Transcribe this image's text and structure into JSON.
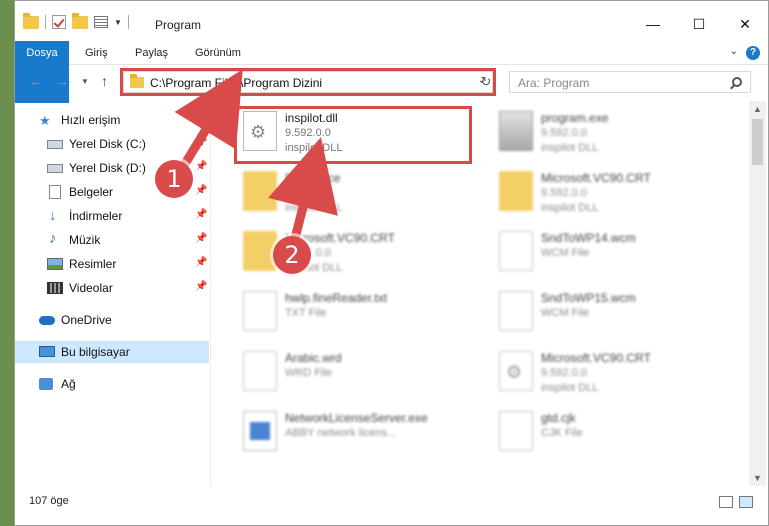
{
  "window": {
    "title": "Program"
  },
  "ribbon": {
    "tabs": [
      "Dosya",
      "Giriş",
      "Paylaş",
      "Görünüm"
    ]
  },
  "address": {
    "path": "C:\\Program Files\\Program Dizini"
  },
  "search": {
    "placeholder": "Ara: Program"
  },
  "sidebar": {
    "items": [
      {
        "label": "Hızlı erişim",
        "icon": "star-icon"
      },
      {
        "label": "Yerel Disk (C:)",
        "icon": "drive-icon"
      },
      {
        "label": "Yerel Disk (D:)",
        "icon": "drive-icon"
      },
      {
        "label": "Belgeler",
        "icon": "documents-icon"
      },
      {
        "label": "İndirmeler",
        "icon": "downloads-icon"
      },
      {
        "label": "Müzik",
        "icon": "music-icon"
      },
      {
        "label": "Resimler",
        "icon": "pictures-icon"
      },
      {
        "label": "Videolar",
        "icon": "videos-icon"
      },
      {
        "label": "OneDrive",
        "icon": "cloud-icon"
      },
      {
        "label": "Bu bilgisayar",
        "icon": "computer-icon"
      },
      {
        "label": "Ağ",
        "icon": "network-icon"
      }
    ]
  },
  "files": [
    {
      "name": "inspilot.dll",
      "line2": "9.592.0.0",
      "line3": "inspilot DLL",
      "icon": "dll-icon"
    },
    {
      "name": "program.exe",
      "line2": "9.592.0.0",
      "line3": "inspilot DLL",
      "icon": "exe-icon"
    },
    {
      "name": "Reference",
      "line2": "9.592.0.0",
      "line3": "inspilot DLL",
      "icon": "folder-icon"
    },
    {
      "name": "Microsoft.VC90.CRT",
      "line2": "9.592.0.0",
      "line3": "inspilot DLL",
      "icon": "folder-icon"
    },
    {
      "name": "Microsoft.VC90.CRT",
      "line2": "9.592.0.0",
      "line3": "inspilot DLL",
      "icon": "folder-icon"
    },
    {
      "name": "SndToWP14.wcm",
      "line2": "WCM File",
      "line3": "",
      "icon": "file-icon"
    },
    {
      "name": "hwlp.fineReader.txt",
      "line2": "TXT File",
      "line3": "",
      "icon": "file-icon"
    },
    {
      "name": "SndToWP15.wcm",
      "line2": "WCM File",
      "line3": "",
      "icon": "file-icon"
    },
    {
      "name": "Arabic.wrd",
      "line2": "WRD File",
      "line3": "",
      "icon": "file-icon"
    },
    {
      "name": "Microsoft.VC90.CRT",
      "line2": "9.592.0.0",
      "line3": "inspilot DLL",
      "icon": "dll-icon"
    },
    {
      "name": "NetworkLicenseServer.exe",
      "line2": "ABBY network licens...",
      "line3": "",
      "icon": "app-icon"
    },
    {
      "name": "gtd.cjk",
      "line2": "CJK File",
      "line3": "",
      "icon": "file-icon"
    }
  ],
  "status": {
    "count": "107 öge"
  },
  "annotations": {
    "marker1": "1",
    "marker2": "2"
  },
  "colors": {
    "accent": "#1979ca",
    "highlight": "#d84a4a",
    "selected": "#cce8ff"
  }
}
